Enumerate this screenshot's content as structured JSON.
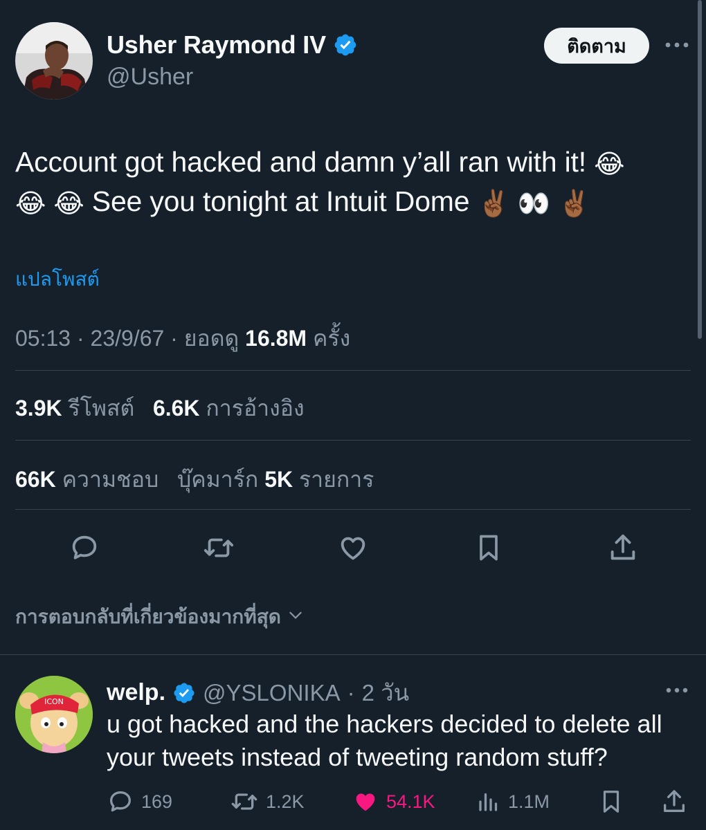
{
  "tweet": {
    "author": {
      "display_name": "Usher Raymond IV",
      "handle": "@Usher",
      "verified": true,
      "follow_label": "ติดตาม"
    },
    "text_line1": "Account got hacked and damn y’all ran with it! ",
    "text_line2": " See you tonight at Intuit Dome ",
    "emoji": {
      "laugh": "😂",
      "peace": "✌🏾",
      "eyes": "👀"
    },
    "translate_label": "แปลโพสต์",
    "time": "05:13",
    "date": "23/9/67",
    "views_prefix": "ยอดดู",
    "views_count": "16.8M",
    "views_suffix": "ครั้ง",
    "stats": {
      "reposts_count": "3.9K",
      "reposts_label": "รีโพสต์",
      "quotes_count": "6.6K",
      "quotes_label": "การอ้างอิง",
      "likes_count": "66K",
      "likes_label": "ความชอบ",
      "bookmarks_label": "บุ๊คมาร์ก",
      "bookmarks_count": "5K",
      "bookmarks_suffix": "รายการ"
    }
  },
  "replies_sort_label": "การตอบกลับที่เกี่ยวข้องมากที่สุด",
  "reply": {
    "display_name": "welp.",
    "verified": true,
    "handle": "@YSLONIKA",
    "age": "2 วัน",
    "text": "u got hacked and the hackers decided to delete all your tweets instead of tweeting random stuff?",
    "avatar_hat_text": "ICON",
    "replies_count": "169",
    "reposts_count": "1.2K",
    "likes_count": "54.1K",
    "views_count": "1.1M"
  },
  "colors": {
    "background": "#15202b",
    "accent": "#1d9bf0",
    "like": "#f91880",
    "muted": "#8b98a5",
    "divider": "#38444d"
  }
}
